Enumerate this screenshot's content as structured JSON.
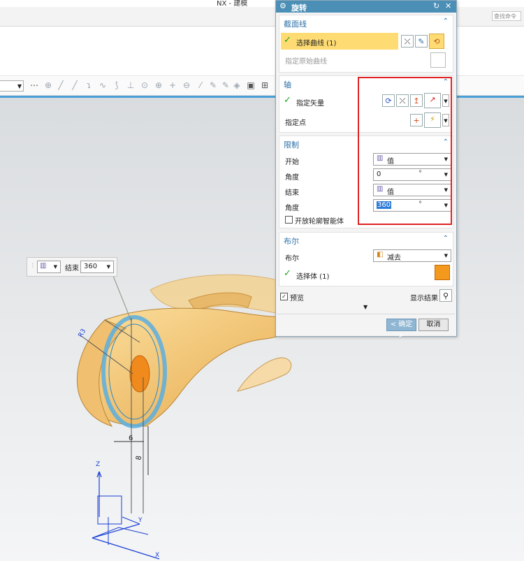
{
  "app_title": "NX - 建模",
  "search_placeholder": "查找命令",
  "dialog": {
    "title": "旋转",
    "section_curve": {
      "title": "截面线",
      "select_curve": "选择曲线 (1)",
      "specify_origin": "指定原始曲线"
    },
    "section_axis": {
      "title": "轴",
      "specify_vector": "指定矢量",
      "specify_point": "指定点"
    },
    "section_limits": {
      "title": "限制",
      "start_label": "开始",
      "start_mode": "值",
      "start_angle_label": "角度",
      "start_angle": "0",
      "end_label": "结束",
      "end_mode": "值",
      "end_angle_label": "角度",
      "end_angle": "360",
      "unit": "°",
      "open_profile": "开放轮廓智能体"
    },
    "section_boolean": {
      "title": "布尔",
      "boolean_label": "布尔",
      "boolean_value": "减去",
      "select_body": "选择体 (1)"
    },
    "preview_label": "预览",
    "show_result": "显示结果",
    "ok": "< 确定 >",
    "cancel": "取消"
  },
  "mini_toolbar": {
    "end_label": "结束",
    "end_value": "360"
  },
  "viewport_labels": {
    "radius": "R3",
    "dim_a": "6",
    "dim_b": "8",
    "axis_z": "Z",
    "axis_y": "Y",
    "axis_x": "X"
  },
  "colors": {
    "dialog_header": "#4b8fb7",
    "selected_row": "#ffdc73",
    "highlight_box": "#e02323",
    "part": "#f2c46e",
    "ring": "#5aaee0"
  }
}
